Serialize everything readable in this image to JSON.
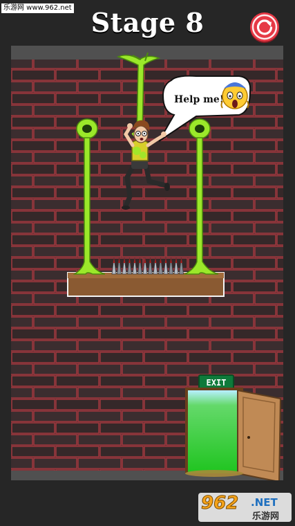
{
  "watermark": {
    "site_text": "乐游网 www.962.net"
  },
  "header": {
    "stage_title": "Stage 8",
    "restart_icon": "restart-icon"
  },
  "scene": {
    "speech_text": "Help me!",
    "speech_emoji": "😱",
    "exit_sign": "EXIT",
    "colors": {
      "brick": "#3a2c2e",
      "mortar": "#a8383f",
      "slime": "#9be82a",
      "exit_glow": "#2fd82f"
    }
  },
  "ad_badge": {
    "logo_text": "962",
    "domain_text": ".NET",
    "site_name": "乐游网"
  }
}
